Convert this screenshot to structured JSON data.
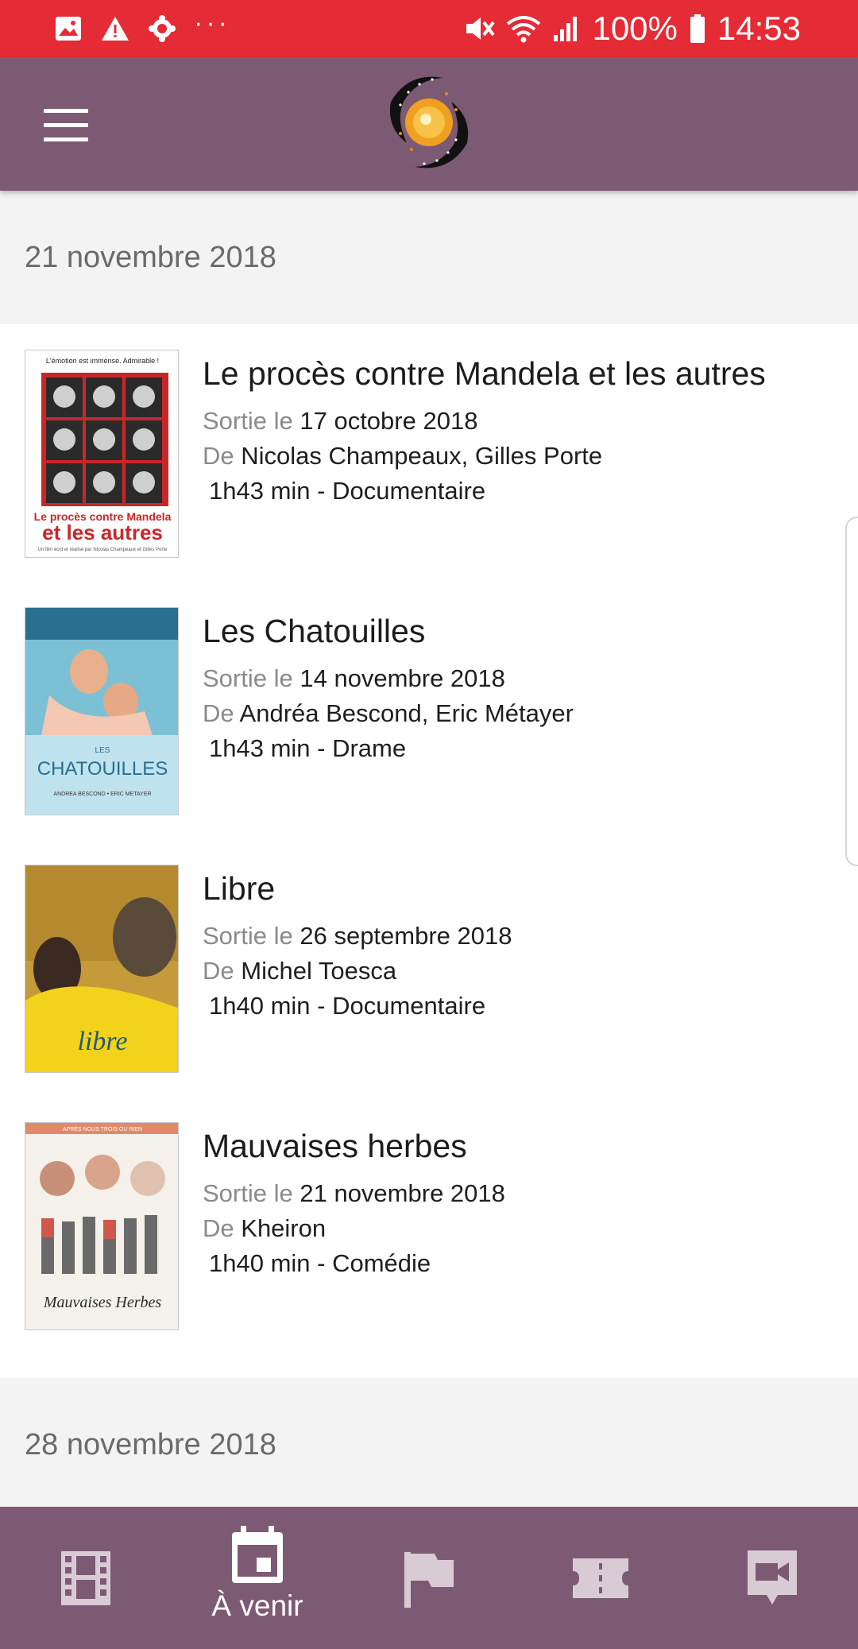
{
  "status_bar": {
    "battery": "100%",
    "time": "14:53",
    "dots": "···"
  },
  "app_bar": {
    "colors": {
      "primary": "#7d5a74",
      "status": "#e52b35"
    }
  },
  "sections": [
    {
      "date": "21 novembre 2018",
      "movies": [
        {
          "title": "Le procès contre Mandela et les autres",
          "release_label": "Sortie le",
          "release_date": "17 octobre 2018",
          "by_label": "De",
          "directors": "Nicolas Champeaux, Gilles Porte",
          "duration_genre": "1h43 min - Documentaire",
          "poster": {
            "top": "L'émotion est immense. Admirable !",
            "line1": "Le procès contre Mandela",
            "line2": "et les autres",
            "credit": "Un film écrit et réalisé par Nicolas Champeaux et Gilles Porte"
          }
        },
        {
          "title": "Les Chatouilles",
          "release_label": "Sortie le",
          "release_date": "14 novembre 2018",
          "by_label": "De",
          "directors": "Andréa Bescond, Eric Métayer",
          "duration_genre": "1h43 min - Drame",
          "poster": {
            "line1": "LES",
            "line2": "CHATOUILLES",
            "credit": "ANDREA BESCOND • ERIC METAYER"
          }
        },
        {
          "title": "Libre",
          "release_label": "Sortie le",
          "release_date": "26 septembre 2018",
          "by_label": "De",
          "directors": "Michel Toesca",
          "duration_genre": "1h40 min - Documentaire",
          "poster": {
            "line1": "libre"
          }
        },
        {
          "title": "Mauvaises herbes",
          "release_label": "Sortie le",
          "release_date": "21 novembre 2018",
          "by_label": "De",
          "directors": "Kheiron",
          "duration_genre": "1h40 min - Comédie",
          "poster": {
            "top": "APRÈS NOUS TROIS OU RIEN",
            "line1": "Mauvaises Herbes"
          }
        }
      ]
    },
    {
      "date": "28 novembre 2018",
      "movies": []
    }
  ],
  "bottom_nav": [
    {
      "icon": "film-icon",
      "label": ""
    },
    {
      "icon": "calendar-icon",
      "label": "À venir",
      "active": true
    },
    {
      "icon": "flag-icon",
      "label": ""
    },
    {
      "icon": "ticket-icon",
      "label": ""
    },
    {
      "icon": "video-chat-icon",
      "label": ""
    }
  ]
}
